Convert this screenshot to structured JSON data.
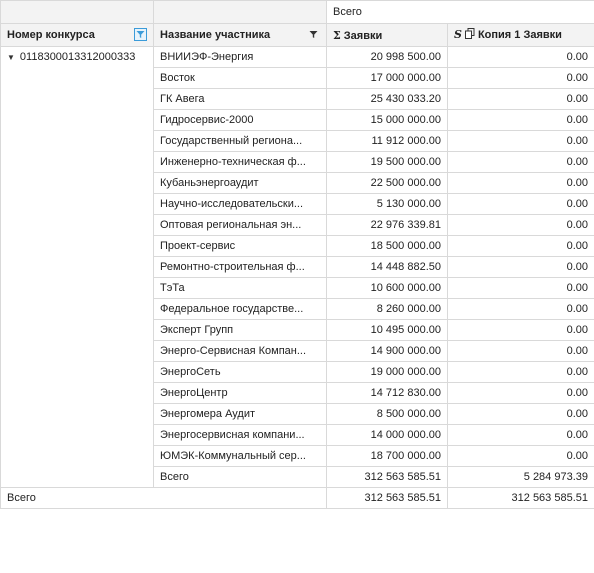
{
  "top_header": {
    "total_label": "Всего"
  },
  "columns": {
    "contest_number": "Номер конкурса",
    "participant_name": "Название участника",
    "applications": "Заявки",
    "copy_applications": "Копия 1 Заявки"
  },
  "icons": {
    "sum": "sigma-icon",
    "copy": "copy-icon",
    "filter_active": "filter-icon",
    "collapse": "triangle-down-icon"
  },
  "colors": {
    "accent": "#3a9bd9",
    "header_bg": "#f3f3f3",
    "grid_line": "#d9d9d9"
  },
  "group": {
    "contest_number": "0118300013312000333",
    "rows": [
      {
        "name": "ВНИИЭФ-Энергия",
        "applications": "20 998 500.00",
        "copy": "0.00"
      },
      {
        "name": "Восток",
        "applications": "17 000 000.00",
        "copy": "0.00"
      },
      {
        "name": "ГК Авега",
        "applications": "25 430 033.20",
        "copy": "0.00"
      },
      {
        "name": "Гидросервис-2000",
        "applications": "15 000 000.00",
        "copy": "0.00"
      },
      {
        "name": "Государственный региона...",
        "applications": "11 912 000.00",
        "copy": "0.00"
      },
      {
        "name": "Инженерно-техническая ф...",
        "applications": "19 500 000.00",
        "copy": "0.00"
      },
      {
        "name": "Кубаньэнергоаудит",
        "applications": "22 500 000.00",
        "copy": "0.00"
      },
      {
        "name": "Научно-исследовательски...",
        "applications": "5 130 000.00",
        "copy": "0.00"
      },
      {
        "name": "Оптовая региональная эн...",
        "applications": "22 976 339.81",
        "copy": "0.00"
      },
      {
        "name": "Проект-сервис",
        "applications": "18 500 000.00",
        "copy": "0.00"
      },
      {
        "name": "Ремонтно-строительная ф...",
        "applications": "14 448 882.50",
        "copy": "0.00"
      },
      {
        "name": "ТэТа",
        "applications": "10 600 000.00",
        "copy": "0.00"
      },
      {
        "name": "Федеральное государстве...",
        "applications": "8 260 000.00",
        "copy": "0.00"
      },
      {
        "name": "Эксперт Групп",
        "applications": "10 495 000.00",
        "copy": "0.00"
      },
      {
        "name": "Энерго-Сервисная Компан...",
        "applications": "14 900 000.00",
        "copy": "0.00"
      },
      {
        "name": "ЭнергоСеть",
        "applications": "19 000 000.00",
        "copy": "0.00"
      },
      {
        "name": "ЭнергоЦентр",
        "applications": "14 712 830.00",
        "copy": "0.00"
      },
      {
        "name": "Энергомера Аудит",
        "applications": "8 500 000.00",
        "copy": "0.00"
      },
      {
        "name": "Энергосервисная компани...",
        "applications": "14 000 000.00",
        "copy": "0.00"
      },
      {
        "name": "ЮМЭК-Коммунальный сер...",
        "applications": "18 700 000.00",
        "copy": "0.00"
      }
    ],
    "subtotal": {
      "label": "Всего",
      "applications": "312 563 585.51",
      "copy": "5 284 973.39"
    }
  },
  "grand_total": {
    "label": "Всего",
    "applications": "312 563 585.51",
    "copy": "312 563 585.51"
  }
}
